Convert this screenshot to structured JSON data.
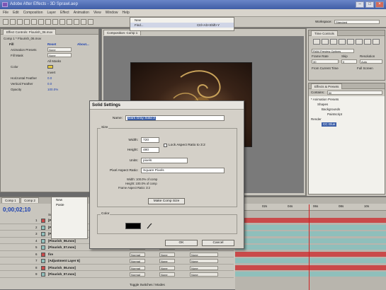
{
  "app": {
    "title": "Adobe After Effects - 3D Sprawl.aep"
  },
  "menu": [
    "File",
    "Edit",
    "Composition",
    "Layer",
    "Effect",
    "Animation",
    "View",
    "Window",
    "Help"
  ],
  "workspace": {
    "label": "Workspace:",
    "value": "Standard"
  },
  "dropdown_menu": {
    "items": [
      {
        "label": "New",
        "shortcut": ""
      },
      {
        "label": "Find...",
        "shortcut": "Ctrl+Alt+Shift+Y"
      }
    ]
  },
  "context_menu": {
    "items": [
      "New",
      "Paste"
    ]
  },
  "effect_controls": {
    "tab": "Effect Controls: Flourish_06.mov",
    "path": "Comp 1 * Flourish_06.mov",
    "fx_name": "Fill",
    "reset": "Reset",
    "about": "About...",
    "rows": [
      {
        "label": "Animation Presets",
        "value": "None"
      },
      {
        "label": "Fill Mask",
        "value": "None"
      },
      {
        "label": "",
        "value": "All Masks"
      },
      {
        "label": "Color",
        "value": ""
      },
      {
        "label": "",
        "value": "Invert"
      },
      {
        "label": "Horizontal Feather",
        "value": "0.0"
      },
      {
        "label": "Vertical Feather",
        "value": "0.0"
      },
      {
        "label": "Opacity",
        "value": "100.0%"
      }
    ]
  },
  "composition": {
    "tab": "Composition: Comp 1",
    "active_camera": "Active Camera"
  },
  "time_controls": {
    "tab": "Time Controls",
    "ram_preview": "RAM Preview Options",
    "frame_rate_label": "Frame Rate",
    "frame_rate": "30",
    "skip_label": "Skip",
    "skip": "0",
    "resolution_label": "Resolution",
    "resolution": "Auto",
    "from_current": "From Current Time",
    "full_screen": "Full Screen"
  },
  "effects_presets": {
    "tab": "Effects & Presets",
    "contains_label": "Contains:",
    "contains": "fill",
    "tree": [
      "* Animation Presets",
      "Shapes",
      "Backgrounds",
      "Paintscript",
      "Render",
      "CC Glue",
      "Fill"
    ]
  },
  "timeline": {
    "tabs": [
      "Comp 1",
      "Comp 2"
    ],
    "timecode": "0;00;02;10",
    "columns": {
      "source": "Source Name",
      "mode": "Mode",
      "trkmat": "TrkMat",
      "parent": "Parent"
    },
    "layers": [
      {
        "idx": "1",
        "name": "[Flourish_06.mov]",
        "mode": "Normal",
        "trk": "",
        "parent": "None",
        "color": "#c94a4a"
      },
      {
        "idx": "2",
        "name": "[Flourish_06.mov]",
        "mode": "Normal",
        "trk": "None",
        "parent": "None",
        "color": "#8fbfbb"
      },
      {
        "idx": "3",
        "name": "[Flourish_06.mov]",
        "mode": "Normal",
        "trk": "None",
        "parent": "None",
        "color": "#8fbfbb"
      },
      {
        "idx": "4",
        "name": "[Flourish_06.mov]",
        "mode": "Classic",
        "trk": "None",
        "parent": "None",
        "color": "#8fbfbb"
      },
      {
        "idx": "5",
        "name": "[Flourish_07.mov]",
        "mode": "Classic",
        "trk": "None",
        "parent": "None",
        "color": "#8fbfbb"
      },
      {
        "idx": "6",
        "name": "fire",
        "mode": "Normal",
        "trk": "None",
        "parent": "None",
        "color": "#c94a4a"
      },
      {
        "idx": "7",
        "name": "[Adjustment Layer 6]",
        "mode": "Normal",
        "trk": "None",
        "parent": "None",
        "color": "#8fbfbb"
      },
      {
        "idx": "8",
        "name": "[Flourish_06.mov]",
        "mode": "Normal",
        "trk": "None",
        "parent": "None",
        "color": "#c94a4a"
      },
      {
        "idx": "9",
        "name": "[Flourish_07.mov]",
        "mode": "Normal",
        "trk": "None",
        "parent": "None",
        "color": "#8fbfbb"
      }
    ],
    "toggle": "Toggle Switches / Modes",
    "ruler": [
      "0s",
      "02s",
      "04s",
      "06s",
      "08s",
      "10s"
    ]
  },
  "solid_dialog": {
    "title": "Solid Settings",
    "name_label": "Name:",
    "name_value": "Dark Gray Solid 3",
    "size_label": "Size",
    "width_label": "Width:",
    "width": "720",
    "height_label": "Height:",
    "height": "480",
    "lock_label": "Lock Aspect Ratio to 3:2",
    "units_label": "Units:",
    "units": "pixels",
    "par_label": "Pixel Aspect Ratio:",
    "par": "Square Pixels",
    "info_width": "Width:   100.0% of comp",
    "info_height": "Height:   100.0% of comp",
    "info_frame": "Frame Aspect Ratio:  3:2",
    "make_comp_size": "Make Comp Size",
    "color_label": "Color",
    "swatch_color": "#000000",
    "ok": "OK",
    "cancel": "Cancel"
  }
}
